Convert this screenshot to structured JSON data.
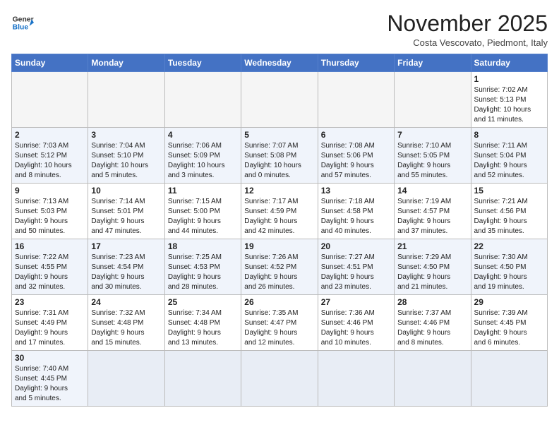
{
  "header": {
    "logo_line1": "General",
    "logo_line2": "Blue",
    "month": "November 2025",
    "location": "Costa Vescovato, Piedmont, Italy"
  },
  "weekdays": [
    "Sunday",
    "Monday",
    "Tuesday",
    "Wednesday",
    "Thursday",
    "Friday",
    "Saturday"
  ],
  "weeks": [
    [
      {
        "day": "",
        "info": ""
      },
      {
        "day": "",
        "info": ""
      },
      {
        "day": "",
        "info": ""
      },
      {
        "day": "",
        "info": ""
      },
      {
        "day": "",
        "info": ""
      },
      {
        "day": "",
        "info": ""
      },
      {
        "day": "1",
        "info": "Sunrise: 7:02 AM\nSunset: 5:13 PM\nDaylight: 10 hours\nand 11 minutes."
      }
    ],
    [
      {
        "day": "2",
        "info": "Sunrise: 7:03 AM\nSunset: 5:12 PM\nDaylight: 10 hours\nand 8 minutes."
      },
      {
        "day": "3",
        "info": "Sunrise: 7:04 AM\nSunset: 5:10 PM\nDaylight: 10 hours\nand 5 minutes."
      },
      {
        "day": "4",
        "info": "Sunrise: 7:06 AM\nSunset: 5:09 PM\nDaylight: 10 hours\nand 3 minutes."
      },
      {
        "day": "5",
        "info": "Sunrise: 7:07 AM\nSunset: 5:08 PM\nDaylight: 10 hours\nand 0 minutes."
      },
      {
        "day": "6",
        "info": "Sunrise: 7:08 AM\nSunset: 5:06 PM\nDaylight: 9 hours\nand 57 minutes."
      },
      {
        "day": "7",
        "info": "Sunrise: 7:10 AM\nSunset: 5:05 PM\nDaylight: 9 hours\nand 55 minutes."
      },
      {
        "day": "8",
        "info": "Sunrise: 7:11 AM\nSunset: 5:04 PM\nDaylight: 9 hours\nand 52 minutes."
      }
    ],
    [
      {
        "day": "9",
        "info": "Sunrise: 7:13 AM\nSunset: 5:03 PM\nDaylight: 9 hours\nand 50 minutes."
      },
      {
        "day": "10",
        "info": "Sunrise: 7:14 AM\nSunset: 5:01 PM\nDaylight: 9 hours\nand 47 minutes."
      },
      {
        "day": "11",
        "info": "Sunrise: 7:15 AM\nSunset: 5:00 PM\nDaylight: 9 hours\nand 44 minutes."
      },
      {
        "day": "12",
        "info": "Sunrise: 7:17 AM\nSunset: 4:59 PM\nDaylight: 9 hours\nand 42 minutes."
      },
      {
        "day": "13",
        "info": "Sunrise: 7:18 AM\nSunset: 4:58 PM\nDaylight: 9 hours\nand 40 minutes."
      },
      {
        "day": "14",
        "info": "Sunrise: 7:19 AM\nSunset: 4:57 PM\nDaylight: 9 hours\nand 37 minutes."
      },
      {
        "day": "15",
        "info": "Sunrise: 7:21 AM\nSunset: 4:56 PM\nDaylight: 9 hours\nand 35 minutes."
      }
    ],
    [
      {
        "day": "16",
        "info": "Sunrise: 7:22 AM\nSunset: 4:55 PM\nDaylight: 9 hours\nand 32 minutes."
      },
      {
        "day": "17",
        "info": "Sunrise: 7:23 AM\nSunset: 4:54 PM\nDaylight: 9 hours\nand 30 minutes."
      },
      {
        "day": "18",
        "info": "Sunrise: 7:25 AM\nSunset: 4:53 PM\nDaylight: 9 hours\nand 28 minutes."
      },
      {
        "day": "19",
        "info": "Sunrise: 7:26 AM\nSunset: 4:52 PM\nDaylight: 9 hours\nand 26 minutes."
      },
      {
        "day": "20",
        "info": "Sunrise: 7:27 AM\nSunset: 4:51 PM\nDaylight: 9 hours\nand 23 minutes."
      },
      {
        "day": "21",
        "info": "Sunrise: 7:29 AM\nSunset: 4:50 PM\nDaylight: 9 hours\nand 21 minutes."
      },
      {
        "day": "22",
        "info": "Sunrise: 7:30 AM\nSunset: 4:50 PM\nDaylight: 9 hours\nand 19 minutes."
      }
    ],
    [
      {
        "day": "23",
        "info": "Sunrise: 7:31 AM\nSunset: 4:49 PM\nDaylight: 9 hours\nand 17 minutes."
      },
      {
        "day": "24",
        "info": "Sunrise: 7:32 AM\nSunset: 4:48 PM\nDaylight: 9 hours\nand 15 minutes."
      },
      {
        "day": "25",
        "info": "Sunrise: 7:34 AM\nSunset: 4:48 PM\nDaylight: 9 hours\nand 13 minutes."
      },
      {
        "day": "26",
        "info": "Sunrise: 7:35 AM\nSunset: 4:47 PM\nDaylight: 9 hours\nand 12 minutes."
      },
      {
        "day": "27",
        "info": "Sunrise: 7:36 AM\nSunset: 4:46 PM\nDaylight: 9 hours\nand 10 minutes."
      },
      {
        "day": "28",
        "info": "Sunrise: 7:37 AM\nSunset: 4:46 PM\nDaylight: 9 hours\nand 8 minutes."
      },
      {
        "day": "29",
        "info": "Sunrise: 7:39 AM\nSunset: 4:45 PM\nDaylight: 9 hours\nand 6 minutes."
      }
    ],
    [
      {
        "day": "30",
        "info": "Sunrise: 7:40 AM\nSunset: 4:45 PM\nDaylight: 9 hours\nand 5 minutes."
      },
      {
        "day": "",
        "info": ""
      },
      {
        "day": "",
        "info": ""
      },
      {
        "day": "",
        "info": ""
      },
      {
        "day": "",
        "info": ""
      },
      {
        "day": "",
        "info": ""
      },
      {
        "day": "",
        "info": ""
      }
    ]
  ]
}
